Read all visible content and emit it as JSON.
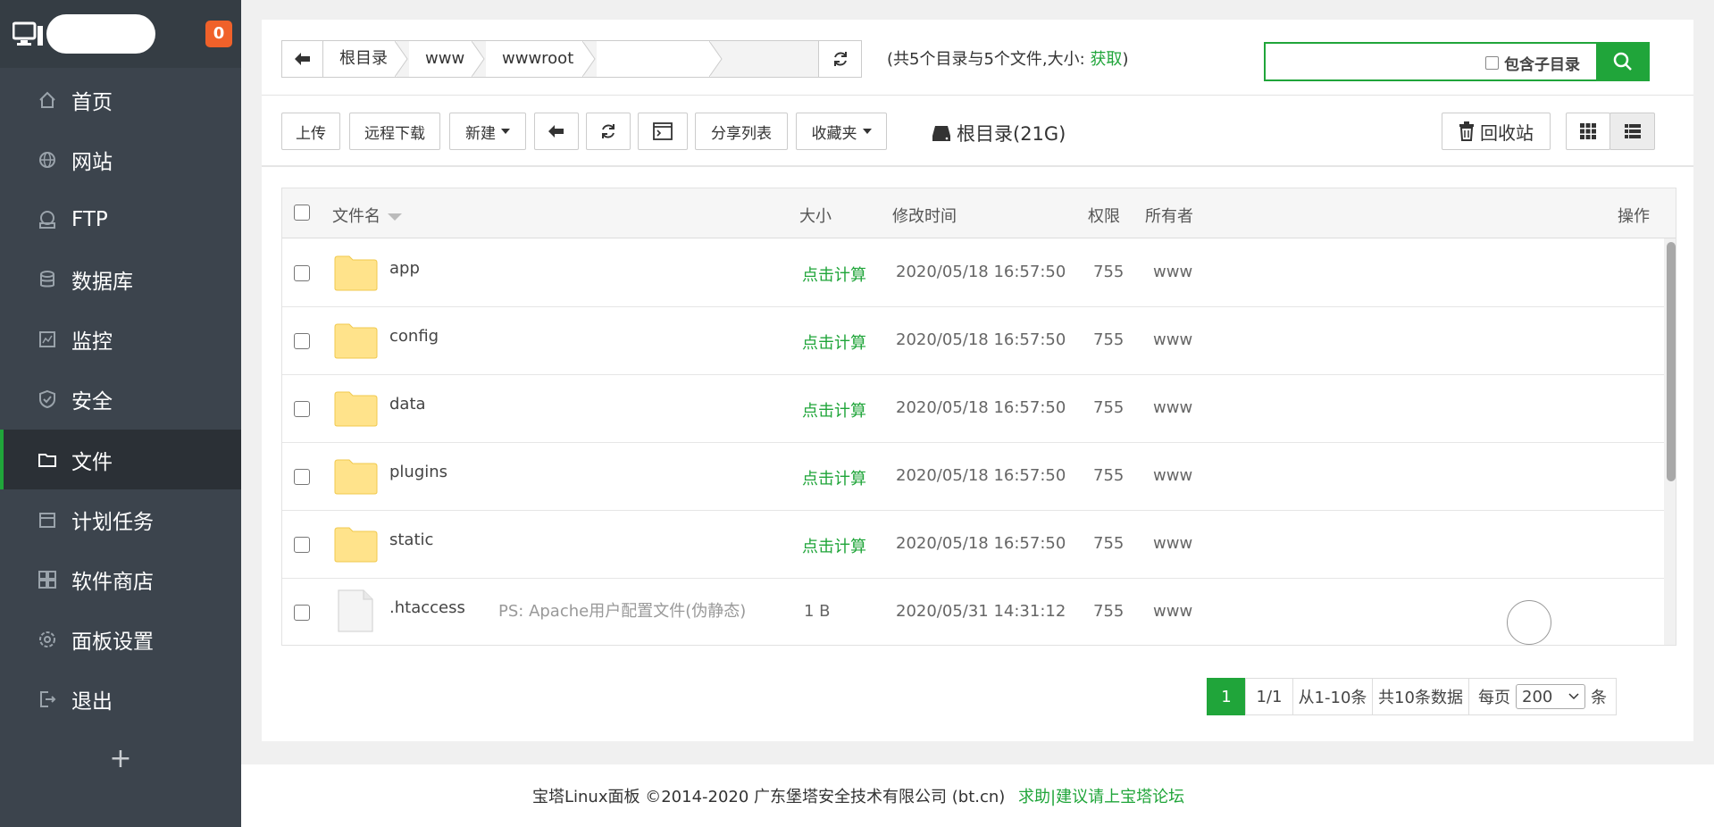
{
  "sidebar": {
    "badge": "0",
    "items": [
      {
        "label": "首页",
        "icon": "home-icon"
      },
      {
        "label": "网站",
        "icon": "globe-icon"
      },
      {
        "label": "FTP",
        "icon": "ftp-icon"
      },
      {
        "label": "数据库",
        "icon": "database-icon"
      },
      {
        "label": "监控",
        "icon": "monitor-icon"
      },
      {
        "label": "安全",
        "icon": "shield-icon"
      },
      {
        "label": "文件",
        "icon": "folder-icon",
        "active": true
      },
      {
        "label": "计划任务",
        "icon": "calendar-icon"
      },
      {
        "label": "软件商店",
        "icon": "apps-icon"
      },
      {
        "label": "面板设置",
        "icon": "gear-icon"
      },
      {
        "label": "退出",
        "icon": "logout-icon"
      }
    ],
    "add_label": "+"
  },
  "path": {
    "crumbs": [
      "根目录",
      "www",
      "wwwroot",
      ""
    ]
  },
  "summary": {
    "prefix": "(共5个目录与5个文件,大小: ",
    "fetch": "获取",
    "suffix": ")"
  },
  "search": {
    "placeholder": "",
    "subdir_label": "包含子目录"
  },
  "toolbar": {
    "upload": "上传",
    "remote_download": "远程下载",
    "new": "新建",
    "share_list": "分享列表",
    "favorites": "收藏夹",
    "disk": "根目录(21G)",
    "recycle": "回收站"
  },
  "table": {
    "headers": {
      "name": "文件名",
      "size": "大小",
      "mtime": "修改时间",
      "perm": "权限",
      "owner": "所有者",
      "ops": "操作"
    },
    "rows": [
      {
        "name": "app",
        "type": "folder",
        "size": "点击计算",
        "mtime": "2020/05/18 16:57:50",
        "perm": "755",
        "owner": "www",
        "ps": ""
      },
      {
        "name": "config",
        "type": "folder",
        "size": "点击计算",
        "mtime": "2020/05/18 16:57:50",
        "perm": "755",
        "owner": "www",
        "ps": ""
      },
      {
        "name": "data",
        "type": "folder",
        "size": "点击计算",
        "mtime": "2020/05/18 16:57:50",
        "perm": "755",
        "owner": "www",
        "ps": ""
      },
      {
        "name": "plugins",
        "type": "folder",
        "size": "点击计算",
        "mtime": "2020/05/18 16:57:50",
        "perm": "755",
        "owner": "www",
        "ps": ""
      },
      {
        "name": "static",
        "type": "folder",
        "size": "点击计算",
        "mtime": "2020/05/18 16:57:50",
        "perm": "755",
        "owner": "www",
        "ps": ""
      },
      {
        "name": ".htaccess",
        "type": "file",
        "size": "1 B",
        "mtime": "2020/05/31 14:31:12",
        "perm": "755",
        "owner": "www",
        "ps": "PS: Apache用户配置文件(伪静态)"
      }
    ]
  },
  "pagination": {
    "current": "1",
    "pages": "1/1",
    "range": "从1-10条",
    "total": "共10条数据",
    "per_page_label": "每页",
    "per_page_value": "200",
    "unit": "条"
  },
  "footer": {
    "copyright": "宝塔Linux面板 ©2014-2020 广东堡塔安全技术有限公司 (bt.cn)",
    "help": "求助|建议请上宝塔论坛"
  },
  "colors": {
    "accent": "#20a53a",
    "sidebar_bg": "#3c444d",
    "badge": "#f0612a"
  }
}
